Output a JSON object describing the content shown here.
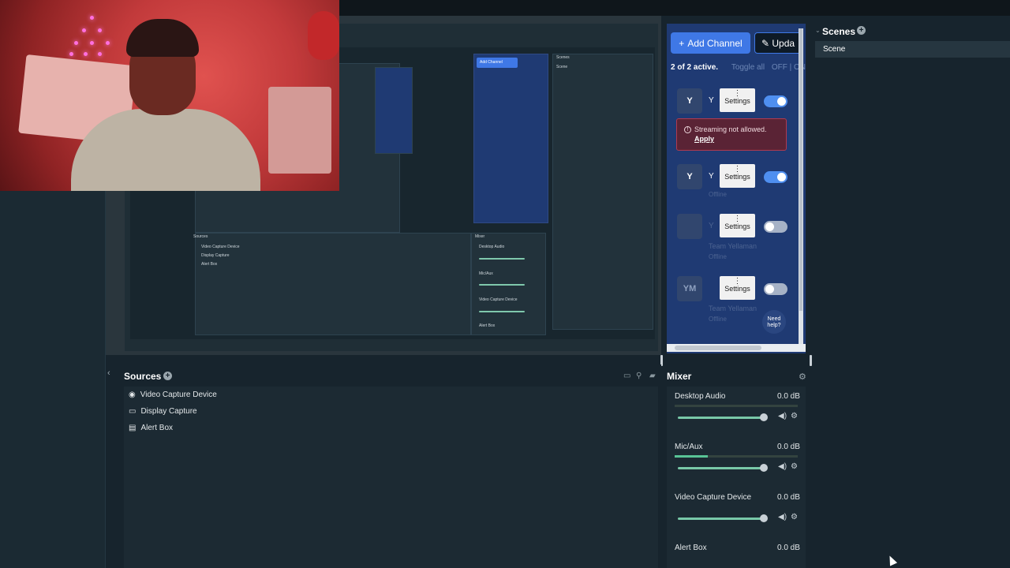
{
  "channels": {
    "add_channel_label": "Add Channel",
    "update_label": "Upda",
    "active_count": "2 of 2 active.",
    "toggle_all": "Toggle all",
    "off_on": "OFF | ON",
    "rows": [
      {
        "avatar": "Y",
        "name": "Y",
        "settings": "Settings",
        "enabled": true
      },
      {
        "avatar": "Y",
        "name": "Y",
        "settings": "Settings",
        "enabled": true,
        "status": "Offline"
      },
      {
        "avatar": "",
        "name": "Y",
        "settings": "Settings",
        "enabled": false,
        "subtitle": "Team Yellaman",
        "status": "Offline"
      },
      {
        "avatar": "YM",
        "name": "",
        "settings": "Settings",
        "enabled": false,
        "subtitle": "Team Yellaman",
        "status": "Offline"
      }
    ],
    "warning": {
      "text": "Streaming not allowed.",
      "apply": "Apply"
    },
    "need_help": "Need help?"
  },
  "scenes": {
    "title": "Scenes",
    "items": [
      "Scene"
    ]
  },
  "sources": {
    "title": "Sources",
    "items": [
      {
        "label": "Video Capture Device",
        "icon": "camera-icon"
      },
      {
        "label": "Display Capture",
        "icon": "monitor-icon"
      },
      {
        "label": "Alert Box",
        "icon": "alert-box-icon"
      }
    ]
  },
  "mixer": {
    "title": "Mixer",
    "items": [
      {
        "label": "Desktop Audio",
        "db": "0.0 dB",
        "meter_level": 0.0
      },
      {
        "label": "Mic/Aux",
        "db": "0.0 dB",
        "meter_level": 0.27
      },
      {
        "label": "Video Capture Device",
        "db": "0.0 dB",
        "meter_level": 0.0
      },
      {
        "label": "Alert Box",
        "db": "0.0 dB",
        "meter_level": 0.0
      }
    ]
  },
  "colors": {
    "accent_blue": "#3f78e6",
    "panel_blue": "#1f3a73",
    "warning_red": "#b23a4f",
    "meter_green": "#58c496"
  }
}
